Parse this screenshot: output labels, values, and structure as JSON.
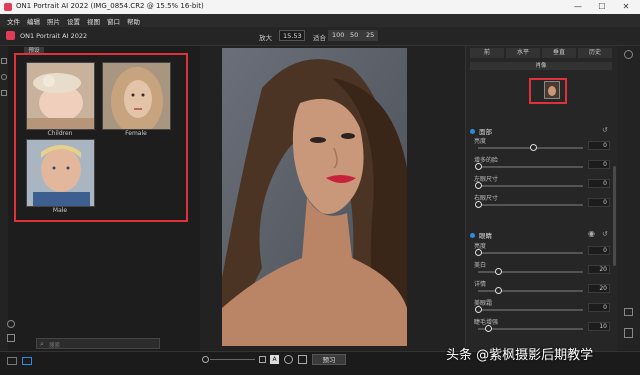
{
  "window": {
    "title": "ON1 Portrait AI 2022 (IMG_0854.CR2 @ 15.5% 16-bit)",
    "min": "—",
    "max": "☐",
    "close": "✕"
  },
  "menubar": {
    "items": [
      "文件",
      "编辑",
      "照片",
      "设置",
      "视图",
      "窗口",
      "帮助"
    ]
  },
  "toolbar": {
    "app_name": "ON1 Portrait AI 2022",
    "zoom_label": "放大",
    "zoom_value": "15.53",
    "fit_label": "适合",
    "zoom_presets": [
      "100",
      "50",
      "25"
    ]
  },
  "left_panel": {
    "tab": "预设",
    "thumbnails": [
      {
        "label": "Children"
      },
      {
        "label": "Female"
      },
      {
        "label": "Male"
      }
    ],
    "search_placeholder": "搜索"
  },
  "right_panel": {
    "tabs": [
      "前",
      "水平",
      "垂直",
      "历史"
    ],
    "faces_tab": "肖像",
    "section_face": {
      "title": "面部",
      "sliders": [
        {
          "label": "亮度",
          "value": "0",
          "level": 0.55
        },
        {
          "label": "增多的脸",
          "value": "0",
          "level": 0.0
        },
        {
          "label": "左眼尺寸",
          "value": "0",
          "level": 0.0
        },
        {
          "label": "右眼尺寸",
          "value": "0",
          "level": 0.0
        }
      ]
    },
    "section_skin": {
      "title": "眼睛",
      "sliders": [
        {
          "label": "亮度",
          "value": "0",
          "level": 0.0
        },
        {
          "label": "美白",
          "value": "20",
          "level": 0.2
        },
        {
          "label": "详情",
          "value": "20",
          "level": 0.2
        },
        {
          "label": "美眼霜",
          "value": "0",
          "level": 0.0
        },
        {
          "label": "睫毛增强",
          "value": "10",
          "level": 0.1
        }
      ]
    }
  },
  "bottom_bar": {
    "done_label": "预习",
    "a_label": "A"
  },
  "watermark": "头条 @紫枫摄影后期教学"
}
